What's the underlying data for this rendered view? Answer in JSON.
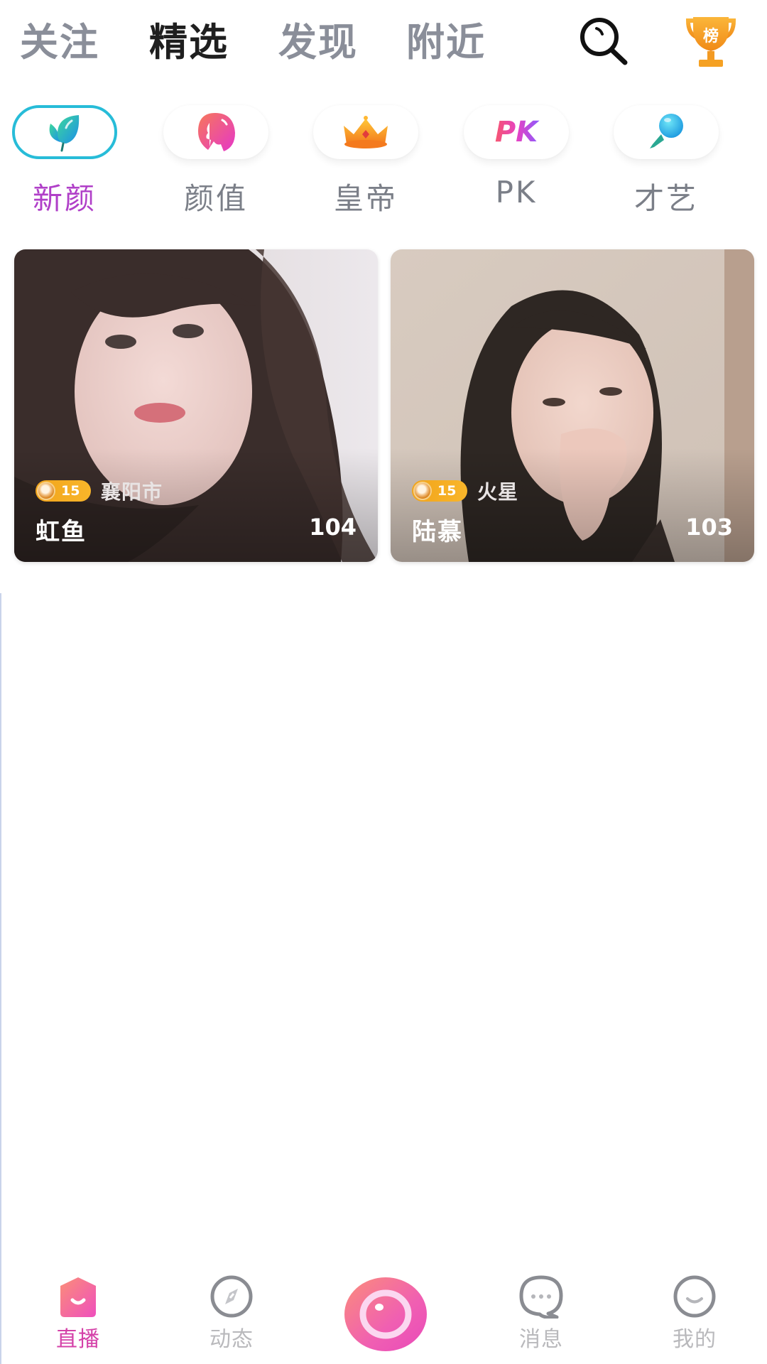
{
  "top_nav": {
    "tabs": [
      {
        "label": "关注",
        "active": false
      },
      {
        "label": "精选",
        "active": true
      },
      {
        "label": "发现",
        "active": false
      },
      {
        "label": "附近",
        "active": false
      }
    ],
    "search_icon": "search-icon",
    "rank_icon": "trophy-icon",
    "rank_label": "榜"
  },
  "categories": [
    {
      "label": "新颜",
      "icon": "leaf-icon",
      "active": true
    },
    {
      "label": "颜值",
      "icon": "face-icon",
      "active": false
    },
    {
      "label": "皇帝",
      "icon": "crown-icon",
      "active": false
    },
    {
      "label": "PK",
      "icon": "pk-icon",
      "active": false
    },
    {
      "label": "才艺",
      "icon": "microphone-icon",
      "active": false
    }
  ],
  "pk_icon_text": "PK",
  "streams": [
    {
      "level": "15",
      "city": "襄阳市",
      "name": "虹鱼",
      "viewers": "104"
    },
    {
      "level": "15",
      "city": "火星",
      "name": "陆慕",
      "viewers": "103"
    }
  ],
  "bottom_nav": {
    "items": [
      {
        "label": "直播",
        "icon": "live-home-icon",
        "active": true
      },
      {
        "label": "动态",
        "icon": "compass-icon",
        "active": false
      },
      {
        "label": "",
        "icon": "camera-start-live-icon",
        "active": false
      },
      {
        "label": "消息",
        "icon": "message-icon",
        "active": false
      },
      {
        "label": "我的",
        "icon": "profile-smile-icon",
        "active": false
      }
    ]
  },
  "colors": {
    "accent_pink": "#e9479f",
    "active_category": "#b03fc8",
    "active_border": "#27bcd8",
    "inactive_text": "#8a8e99",
    "badge_orange": "#f5a623"
  }
}
